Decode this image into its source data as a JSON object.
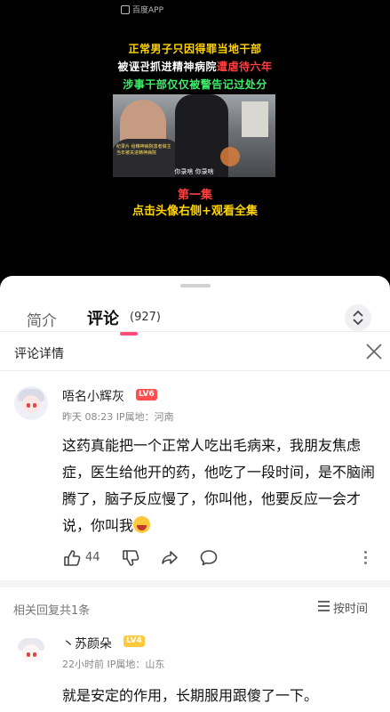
{
  "video": {
    "watermark": "百度APP",
    "headline_line1": "正常男子只因得罪当地干部",
    "headline_line2_a": "被诬관抓进精神病院",
    "headline_line2_b": "遭虐待六年",
    "headline_line3": "涉事干部仅仅被警告记过处分",
    "frame_caption": "纪录片 给精神病院患者做主\n当年被关进精神病院",
    "frame_subtitle": "你录啥  你录啥",
    "episode": "第一集",
    "cta": "点击头像右侧+观看全集"
  },
  "tabs": {
    "intro": "简介",
    "comments": "评论",
    "comments_count": "(927)"
  },
  "detail": {
    "title": "评论详情"
  },
  "comment": {
    "username": "唔名小辉灰",
    "level": "LV6",
    "meta": "昨天 08:23 IP属地：河南",
    "text": "这药真能把一个正常人吃出毛病来，我朋友焦虑症，医生给他开的药，他吃了一段时间，是不脑闹腾了，脑子反应慢了，你叫他，他要反应一会才说，你叫我",
    "likes": "44"
  },
  "replies": {
    "label": "相关回复共1条",
    "sort": "按时间"
  },
  "reply": {
    "username": "丶苏颜朵",
    "level": "LV4",
    "meta": "22小时前 IP属地：山东",
    "text": "就是安定的作用，长期服用跟傻了一下。"
  },
  "colors": {
    "accent_pink": "#ff4d79",
    "headline_yellow": "#ffd400",
    "headline_red": "#ff4040",
    "headline_green": "#3df06a"
  }
}
